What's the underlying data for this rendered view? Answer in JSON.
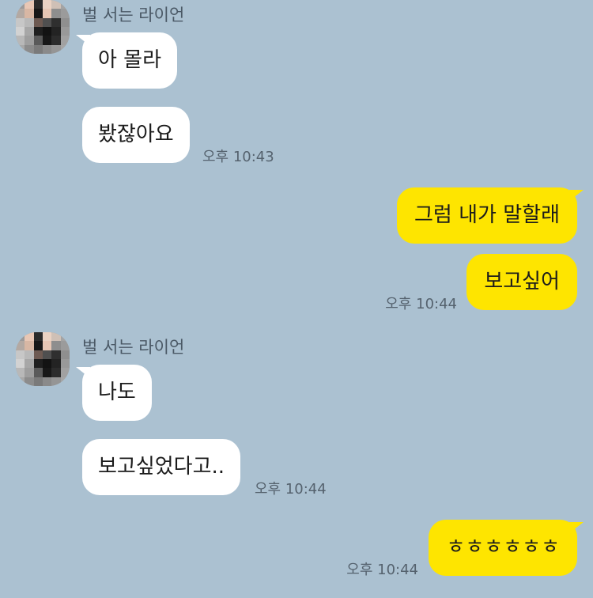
{
  "sender_name": "벌 서는 라이언",
  "messages": [
    {
      "text": "아 몰라"
    },
    {
      "text": "봤잖아요",
      "time": "오후 10:43"
    },
    {
      "text": "그럼 내가 말할래"
    },
    {
      "text": "보고싶어",
      "time": "오후 10:44"
    },
    {
      "text": "나도"
    },
    {
      "text": "보고싶었다고..",
      "time": "오후 10:44"
    },
    {
      "text": "ㅎㅎㅎㅎㅎㅎ",
      "time": "오후 10:44"
    }
  ],
  "colors": {
    "background": "#abc1d1",
    "incoming_bubble": "#ffffff",
    "outgoing_bubble": "#fee500",
    "timestamp": "#55626e"
  },
  "icons": {
    "avatar": "pixelated-profile-avatar"
  }
}
